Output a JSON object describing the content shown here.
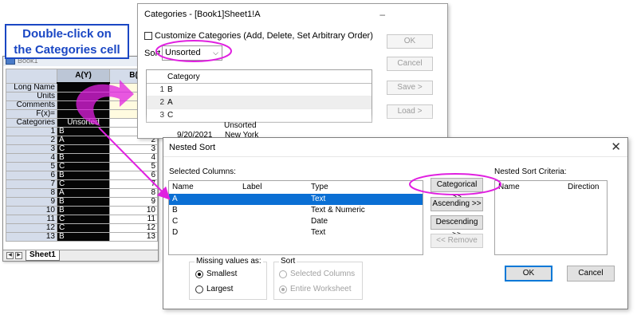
{
  "callout": {
    "line1": "Double-click on",
    "line2": "the Categories cell"
  },
  "worksheet": {
    "title": "Book1",
    "col_a": "A(Y)",
    "col_b": "B(",
    "label_rows": [
      {
        "name": "Long Name",
        "a": "",
        "b": ""
      },
      {
        "name": "Units",
        "a": "",
        "b": ""
      },
      {
        "name": "Comments",
        "a": "",
        "b": ""
      },
      {
        "name": "F(x)=",
        "a": "",
        "b": ""
      },
      {
        "name": "Categories",
        "a": "Unsorted",
        "b": ""
      }
    ],
    "rows": [
      {
        "n": "1",
        "a": "B",
        "b": "1"
      },
      {
        "n": "2",
        "a": "A",
        "b": "2"
      },
      {
        "n": "3",
        "a": "C",
        "b": "3"
      },
      {
        "n": "4",
        "a": "B",
        "b": "4"
      },
      {
        "n": "5",
        "a": "C",
        "b": "5"
      },
      {
        "n": "6",
        "a": "B",
        "b": "6"
      },
      {
        "n": "7",
        "a": "C",
        "b": "7"
      },
      {
        "n": "8",
        "a": "A",
        "b": "8"
      },
      {
        "n": "9",
        "a": "B",
        "b": "9"
      },
      {
        "n": "10",
        "a": "B",
        "b": "10"
      },
      {
        "n": "11",
        "a": "C",
        "b": "11"
      },
      {
        "n": "12",
        "a": "C",
        "b": "12"
      },
      {
        "n": "13",
        "a": "B",
        "b": "13"
      }
    ],
    "sheet_tab": "Sheet1"
  },
  "ghost": {
    "unsorted": "Unsorted",
    "date": "9/20/2021",
    "city": "New York"
  },
  "categories_dialog": {
    "title": "Categories - [Book1]Sheet1!A",
    "minimize": "–",
    "customize_label": "Customize Categories (Add, Delete, Set Arbitrary Order)",
    "sort_label": "Sort",
    "sort_value": "Unsorted",
    "table_header": "Category",
    "rows": [
      {
        "idx": "1",
        "val": "B"
      },
      {
        "idx": "2",
        "val": "A"
      },
      {
        "idx": "3",
        "val": "C"
      }
    ],
    "buttons": {
      "ok": "OK",
      "cancel": "Cancel",
      "save": "Save >",
      "load": "Load >"
    }
  },
  "nested_sort": {
    "title": "Nested Sort",
    "close": "✕",
    "selected_columns_label": "Selected Columns:",
    "criteria_label": "Nested Sort Criteria:",
    "headers": {
      "name": "Name",
      "label": "Label",
      "type": "Type",
      "direction": "Direction"
    },
    "columns": [
      {
        "name": "A",
        "label": "",
        "type": "Text"
      },
      {
        "name": "B",
        "label": "",
        "type": "Text & Numeric"
      },
      {
        "name": "C",
        "label": "",
        "type": "Date"
      },
      {
        "name": "D",
        "label": "",
        "type": "Text"
      }
    ],
    "buttons": {
      "categorical": "Categorical >>",
      "ascending": "Ascending >>",
      "descending": "Descending >>",
      "remove": "<< Remove",
      "ok": "OK",
      "cancel": "Cancel"
    },
    "missing_values": {
      "label": "Missing values as:",
      "smallest": "Smallest",
      "largest": "Largest"
    },
    "sort_group": {
      "label": "Sort",
      "selected": "Selected Columns",
      "entire": "Entire Worksheet"
    }
  },
  "colors": {
    "highlight": "#e020e0",
    "callout": "#1a47c4",
    "selection": "#0a6fd4"
  }
}
